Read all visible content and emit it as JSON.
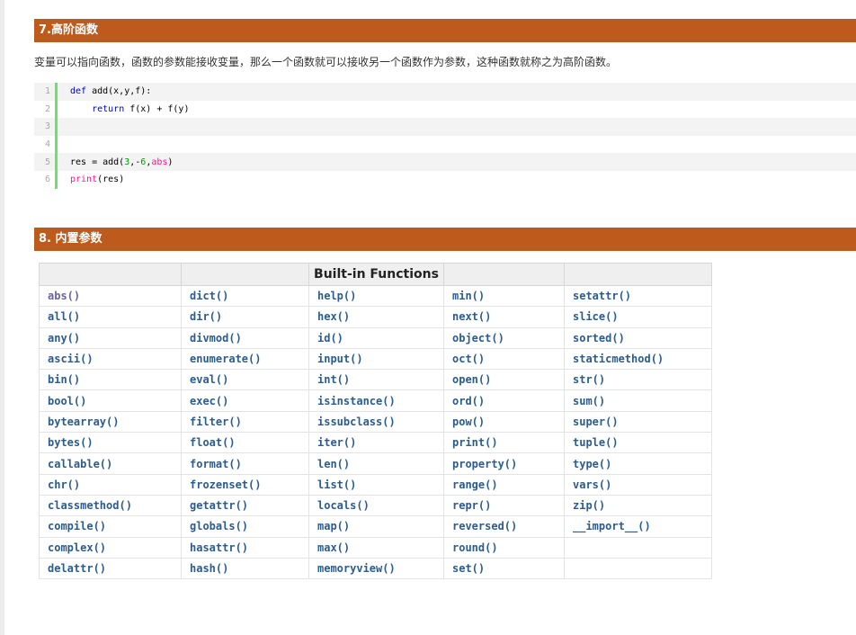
{
  "section7": {
    "title": "7.高阶函数",
    "paragraph": "变量可以指向函数，函数的参数能接收变量，那么一个函数就可以接收另一个函数作为参数，这种函数就称之为高阶函数。",
    "code": [
      {
        "n": "1",
        "text": "def add(x,y,f):"
      },
      {
        "n": "2",
        "text": "    return f(x) + f(y)"
      },
      {
        "n": "3",
        "text": ""
      },
      {
        "n": "4",
        "text": ""
      },
      {
        "n": "5",
        "text": "res = add(3,-6,abs)"
      },
      {
        "n": "6",
        "text": "print(res)"
      }
    ]
  },
  "section8": {
    "title": "8. 内置参数",
    "table_header": "Built-in Functions",
    "rows": [
      [
        "abs()",
        "dict()",
        "help()",
        "min()",
        "setattr()"
      ],
      [
        "all()",
        "dir()",
        "hex()",
        "next()",
        "slice()"
      ],
      [
        "any()",
        "divmod()",
        "id()",
        "object()",
        "sorted()"
      ],
      [
        "ascii()",
        "enumerate()",
        "input()",
        "oct()",
        "staticmethod()"
      ],
      [
        "bin()",
        "eval()",
        "int()",
        "open()",
        "str()"
      ],
      [
        "bool()",
        "exec()",
        "isinstance()",
        "ord()",
        "sum()"
      ],
      [
        "bytearray()",
        "filter()",
        "issubclass()",
        "pow()",
        "super()"
      ],
      [
        "bytes()",
        "float()",
        "iter()",
        "print()",
        "tuple()"
      ],
      [
        "callable()",
        "format()",
        "len()",
        "property()",
        "type()"
      ],
      [
        "chr()",
        "frozenset()",
        "list()",
        "range()",
        "vars()"
      ],
      [
        "classmethod()",
        "getattr()",
        "locals()",
        "repr()",
        "zip()"
      ],
      [
        "compile()",
        "globals()",
        "map()",
        "reversed()",
        "__import__()"
      ],
      [
        "complex()",
        "hasattr()",
        "max()",
        "round()",
        ""
      ],
      [
        "delattr()",
        "hash()",
        "memoryview()",
        "set()",
        ""
      ]
    ]
  },
  "colors": {
    "header_bg": "#bd5a1c",
    "function_link": "#2b5c8f",
    "keyword": "#0000cc",
    "builtin": "#ff1493"
  }
}
